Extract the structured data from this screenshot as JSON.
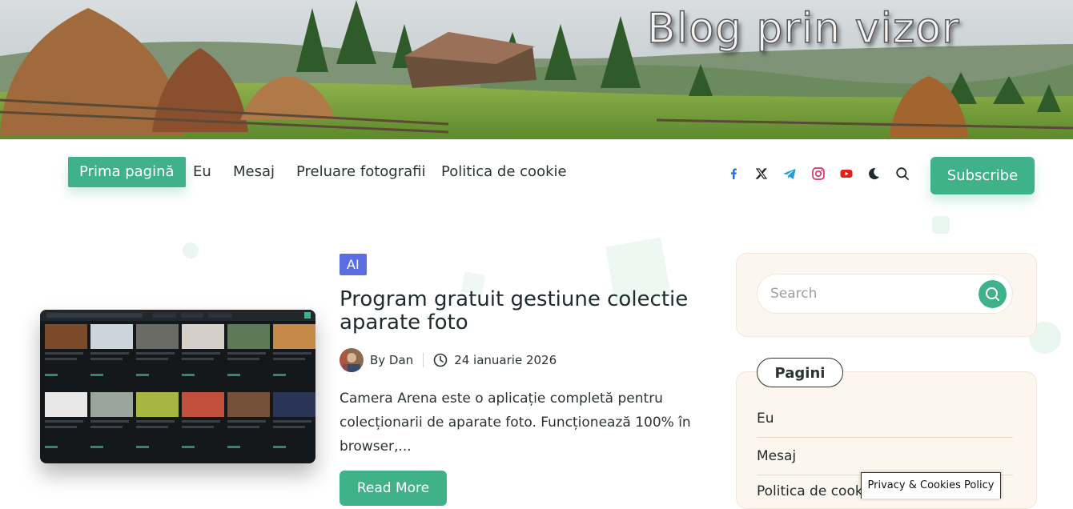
{
  "site": {
    "title": "Blog prin vizor"
  },
  "nav": {
    "items": [
      "Prima pagină",
      "Eu",
      "Mesaj",
      "Preluare fotografii",
      "Politica de cookie"
    ],
    "subscribe_label": "Subscribe",
    "social_icons": [
      "facebook-icon",
      "x-icon",
      "telegram-icon",
      "instagram-icon",
      "youtube-icon",
      "dark-mode-icon",
      "search-icon"
    ]
  },
  "post": {
    "category": "AI",
    "title": "Program gratuit gestiune colectie aparate foto",
    "author": "By Dan",
    "date": "24 ianuarie 2026",
    "excerpt": "Camera Arena este o aplicație completă pentru colecționarii de aparate foto. Funcționează 100% în browser,...",
    "read_more": "Read More"
  },
  "sidebar": {
    "search_placeholder": "Search",
    "pages_title": "Pagini",
    "pages": [
      "Eu",
      "Mesaj",
      "Politica de cookie"
    ]
  },
  "cookie_badge": "Privacy & Cookies Policy",
  "colors": {
    "accent": "#3fb28a",
    "tag": "#5b6ee1",
    "sidebar_bg": "#fdf6ee"
  }
}
